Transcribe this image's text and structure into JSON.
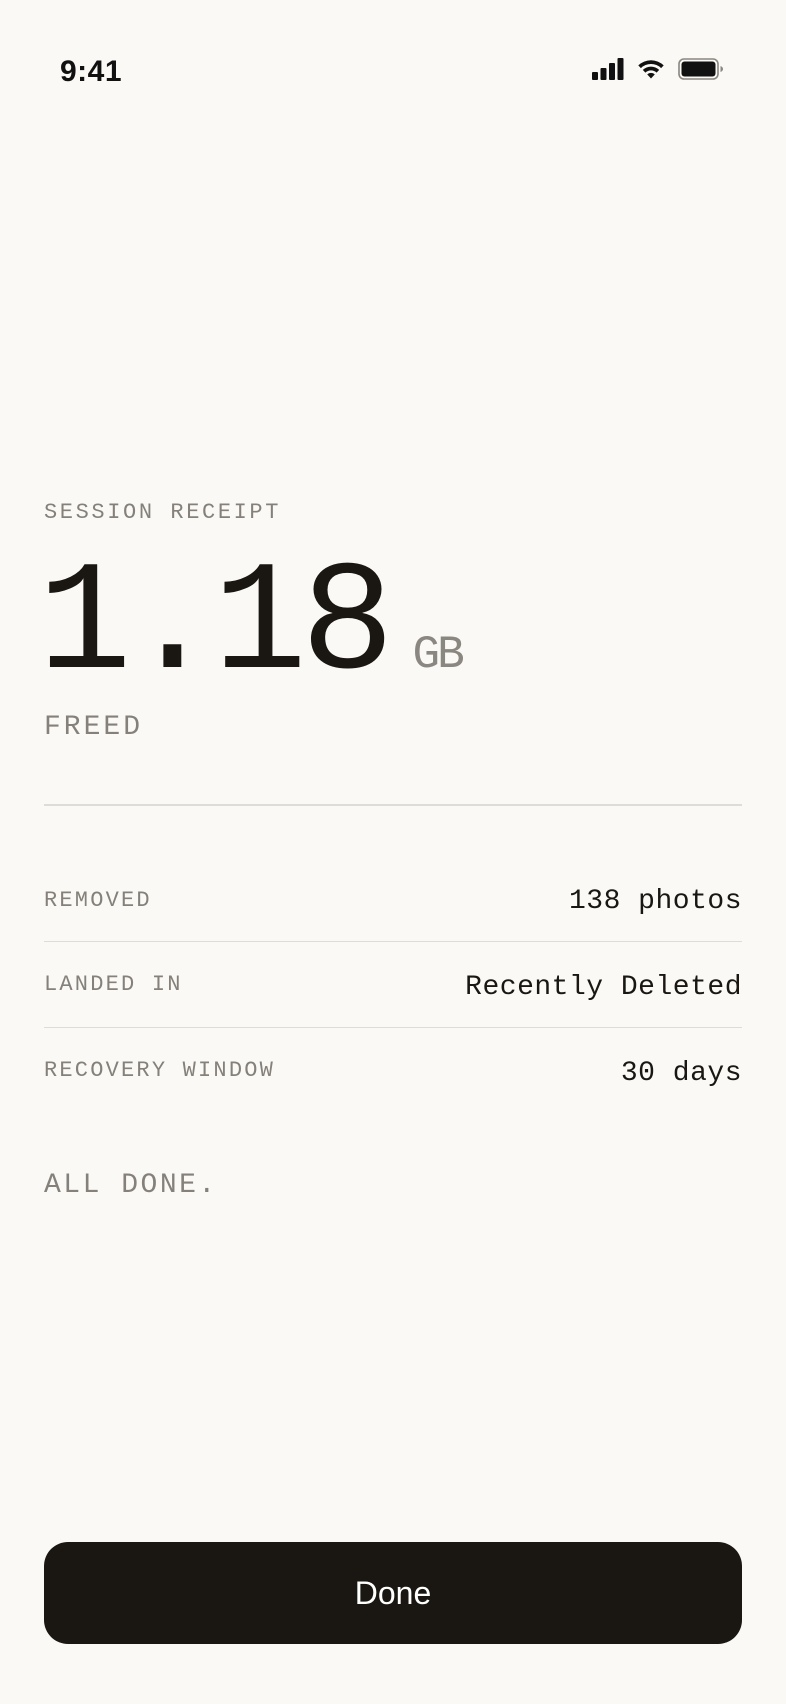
{
  "status_bar": {
    "time": "9:41",
    "icons": [
      "cellular-signal-icon",
      "wifi-icon",
      "battery-icon"
    ]
  },
  "receipt": {
    "eyebrow": "SESSION RECEIPT",
    "amount": "1.18",
    "unit": "GB",
    "caption": "FREED"
  },
  "details": [
    {
      "label": "REMOVED",
      "value": "138 photos"
    },
    {
      "label": "LANDED IN",
      "value": "Recently Deleted"
    },
    {
      "label": "RECOVERY WINDOW",
      "value": "30 days"
    }
  ],
  "footer_note": "ALL DONE.",
  "done_button": {
    "label": "Done"
  },
  "colors": {
    "background": "#faf9f6",
    "ink": "#1a1712",
    "muted": "#85817a",
    "divider": "#dedcd6",
    "button_bg": "#1a1712",
    "button_text": "#ffffff"
  }
}
